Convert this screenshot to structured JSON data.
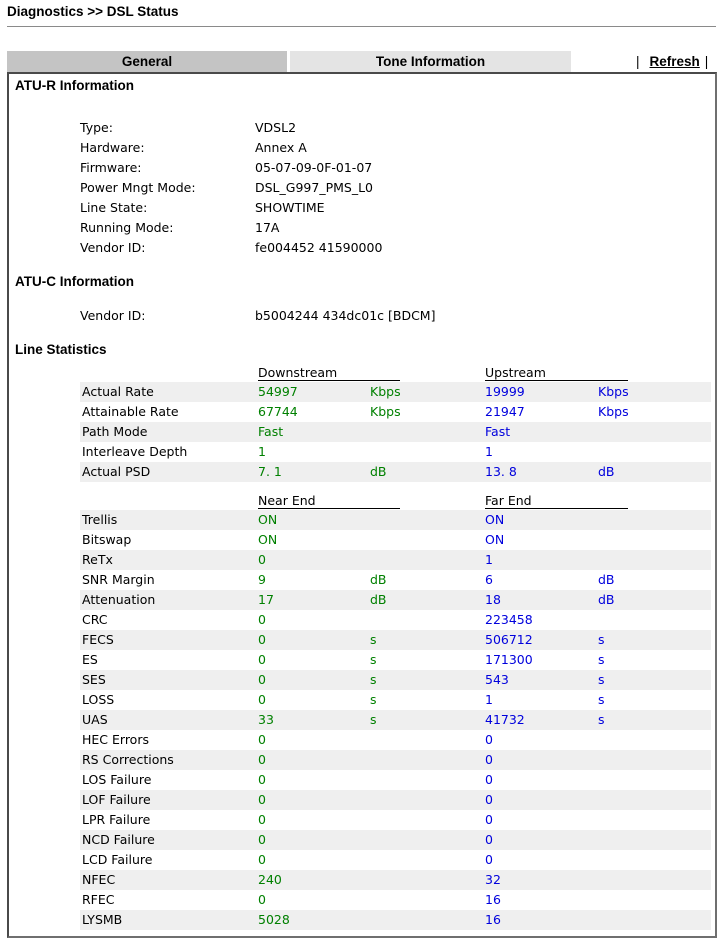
{
  "header": {
    "title": "Diagnostics >> DSL Status"
  },
  "tabs": [
    {
      "label": "General",
      "active": true
    },
    {
      "label": "Tone Information",
      "active": false
    }
  ],
  "toolbar": {
    "separator": "|",
    "refresh_label": "Refresh"
  },
  "atu_r": {
    "title": "ATU-R Information",
    "items": [
      {
        "label": "Type:",
        "value": "VDSL2"
      },
      {
        "label": "Hardware:",
        "value": "Annex A"
      },
      {
        "label": "Firmware:",
        "value": "05-07-09-0F-01-07"
      },
      {
        "label": "Power Mngt Mode:",
        "value": "DSL_G997_PMS_L0"
      },
      {
        "label": "Line State:",
        "value": "SHOWTIME"
      },
      {
        "label": "Running Mode:",
        "value": "17A"
      },
      {
        "label": "Vendor ID:",
        "value": "fe004452 41590000"
      }
    ]
  },
  "atu_c": {
    "title": "ATU-C Information",
    "items": [
      {
        "label": "Vendor ID:",
        "value": "b5004244 434dc01c [BDCM]"
      }
    ]
  },
  "line_stats": {
    "title": "Line Statistics",
    "group1": {
      "col1_header": "Downstream",
      "col2_header": "Upstream",
      "rows": [
        {
          "label": "Actual Rate",
          "down": "54997",
          "down_unit": "Kbps",
          "up": "19999",
          "up_unit": "Kbps"
        },
        {
          "label": "Attainable Rate",
          "down": "67744",
          "down_unit": "Kbps",
          "up": "21947",
          "up_unit": "Kbps"
        },
        {
          "label": "Path Mode",
          "down": "Fast",
          "down_unit": "",
          "up": "Fast",
          "up_unit": ""
        },
        {
          "label": "Interleave Depth",
          "down": "1",
          "down_unit": "",
          "up": "1",
          "up_unit": ""
        },
        {
          "label": "Actual PSD",
          "down": "7. 1",
          "down_unit": "dB",
          "up": "13. 8",
          "up_unit": "dB"
        }
      ]
    },
    "group2": {
      "col1_header": "Near End",
      "col2_header": "Far End",
      "rows": [
        {
          "label": "Trellis",
          "down": "ON",
          "down_unit": "",
          "up": "ON",
          "up_unit": ""
        },
        {
          "label": "Bitswap",
          "down": "ON",
          "down_unit": "",
          "up": "ON",
          "up_unit": ""
        },
        {
          "label": "ReTx",
          "down": "0",
          "down_unit": "",
          "up": "1",
          "up_unit": ""
        },
        {
          "label": "SNR Margin",
          "down": "9",
          "down_unit": "dB",
          "up": "6",
          "up_unit": "dB"
        },
        {
          "label": "Attenuation",
          "down": "17",
          "down_unit": "dB",
          "up": "18",
          "up_unit": "dB"
        },
        {
          "label": "CRC",
          "down": "0",
          "down_unit": "",
          "up": "223458",
          "up_unit": ""
        },
        {
          "label": "FECS",
          "down": "0",
          "down_unit": "s",
          "up": "506712",
          "up_unit": "s"
        },
        {
          "label": "ES",
          "down": "0",
          "down_unit": "s",
          "up": "171300",
          "up_unit": "s"
        },
        {
          "label": "SES",
          "down": "0",
          "down_unit": "s",
          "up": "543",
          "up_unit": "s"
        },
        {
          "label": "LOSS",
          "down": "0",
          "down_unit": "s",
          "up": "1",
          "up_unit": "s"
        },
        {
          "label": "UAS",
          "down": "33",
          "down_unit": "s",
          "up": "41732",
          "up_unit": "s"
        },
        {
          "label": "HEC Errors",
          "down": "0",
          "down_unit": "",
          "up": "0",
          "up_unit": ""
        },
        {
          "label": "RS Corrections",
          "down": "0",
          "down_unit": "",
          "up": "0",
          "up_unit": ""
        },
        {
          "label": "LOS Failure",
          "down": "0",
          "down_unit": "",
          "up": "0",
          "up_unit": ""
        },
        {
          "label": "LOF Failure",
          "down": "0",
          "down_unit": "",
          "up": "0",
          "up_unit": ""
        },
        {
          "label": "LPR Failure",
          "down": "0",
          "down_unit": "",
          "up": "0",
          "up_unit": ""
        },
        {
          "label": "NCD Failure",
          "down": "0",
          "down_unit": "",
          "up": "0",
          "up_unit": ""
        },
        {
          "label": "LCD Failure",
          "down": "0",
          "down_unit": "",
          "up": "0",
          "up_unit": ""
        },
        {
          "label": "NFEC",
          "down": "240",
          "down_unit": "",
          "up": "32",
          "up_unit": ""
        },
        {
          "label": "RFEC",
          "down": "0",
          "down_unit": "",
          "up": "16",
          "up_unit": ""
        },
        {
          "label": "LYSMB",
          "down": "5028",
          "down_unit": "",
          "up": "16",
          "up_unit": ""
        }
      ]
    }
  },
  "colors": {
    "downstream_value": "#008000",
    "upstream_value": "#0000dd",
    "active_tab": "#c4c4c4",
    "inactive_tab": "#e4e4e4",
    "row_alt": "#efefef"
  }
}
